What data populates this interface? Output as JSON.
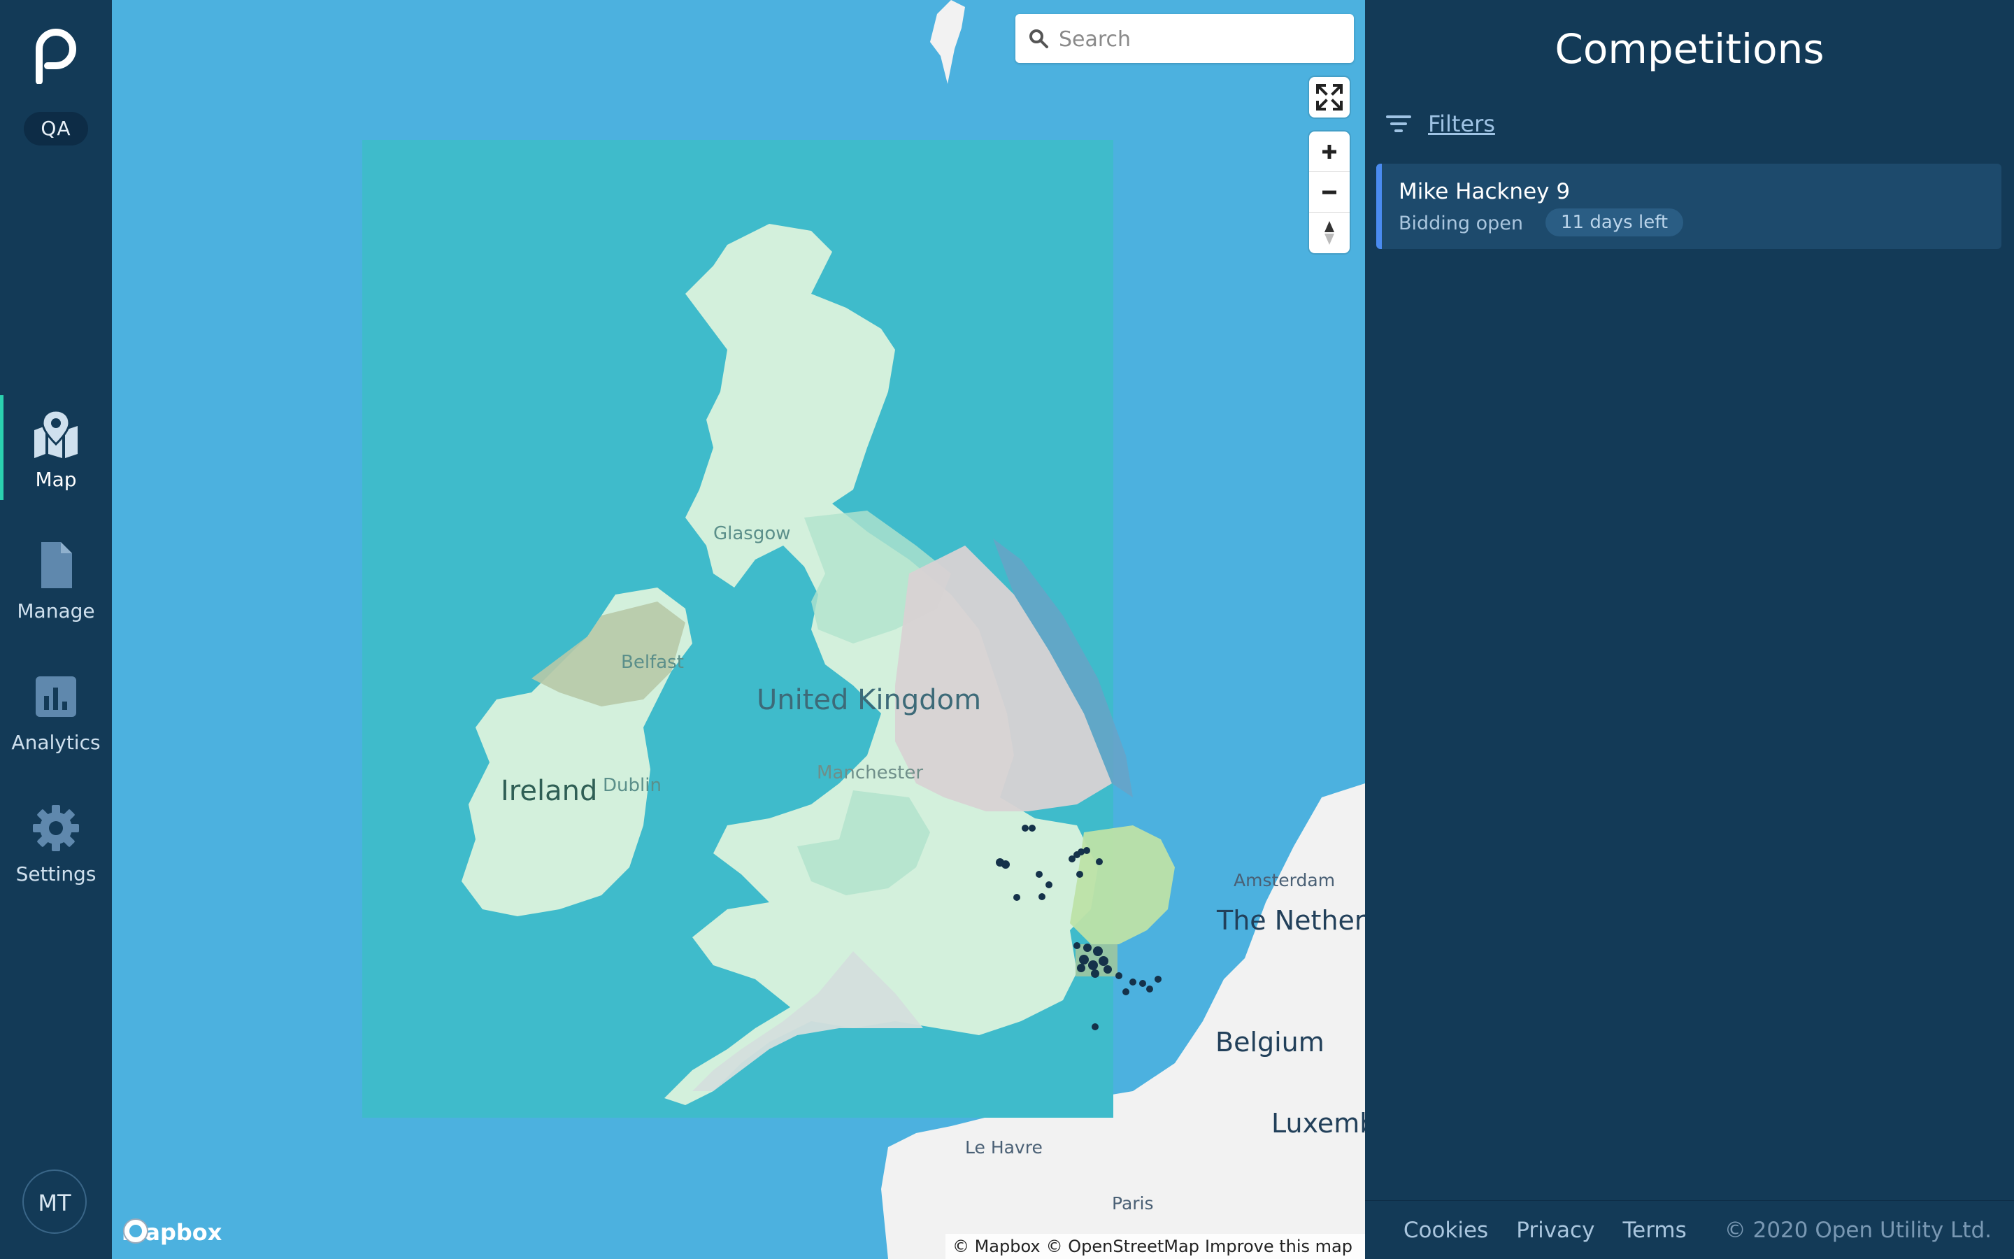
{
  "app": {
    "environment": "QA",
    "user_initials": "MT"
  },
  "sidebar": {
    "items": [
      {
        "label": "Map",
        "icon": "map-pin-icon",
        "active": true
      },
      {
        "label": "Manage",
        "icon": "document-icon",
        "active": false
      },
      {
        "label": "Analytics",
        "icon": "bar-chart-icon",
        "active": false
      },
      {
        "label": "Settings",
        "icon": "gear-icon",
        "active": false
      }
    ]
  },
  "map": {
    "search_placeholder": "Search",
    "labels": {
      "uk": "United Kingdom",
      "ireland": "Ireland",
      "glasgow": "Glasgow",
      "belfast": "Belfast",
      "dublin": "Dublin",
      "manchester": "Manchester",
      "amsterdam": "Amsterdam",
      "netherlands": "The Netherl",
      "belgium": "Belgium",
      "luxembourg": "Luxemb",
      "le_havre": "Le Havre",
      "paris": "Paris"
    },
    "logo_text": "mapbox",
    "attribution": [
      "© Mapbox",
      "© OpenStreetMap",
      "Improve this map"
    ],
    "colors": {
      "water": "#4cb1df",
      "overlay": "#3fbbcb",
      "land": "#d3f0dc",
      "marker": "#15324a"
    }
  },
  "panel": {
    "title": "Competitions",
    "filters_label": "Filters",
    "competitions": [
      {
        "name": "Mike Hackney 9",
        "status": "Bidding open",
        "time_left": "11 days left"
      }
    ]
  },
  "footer": {
    "links": [
      "Cookies",
      "Privacy",
      "Terms"
    ],
    "copyright": "© 2020 Open Utility Ltd."
  }
}
